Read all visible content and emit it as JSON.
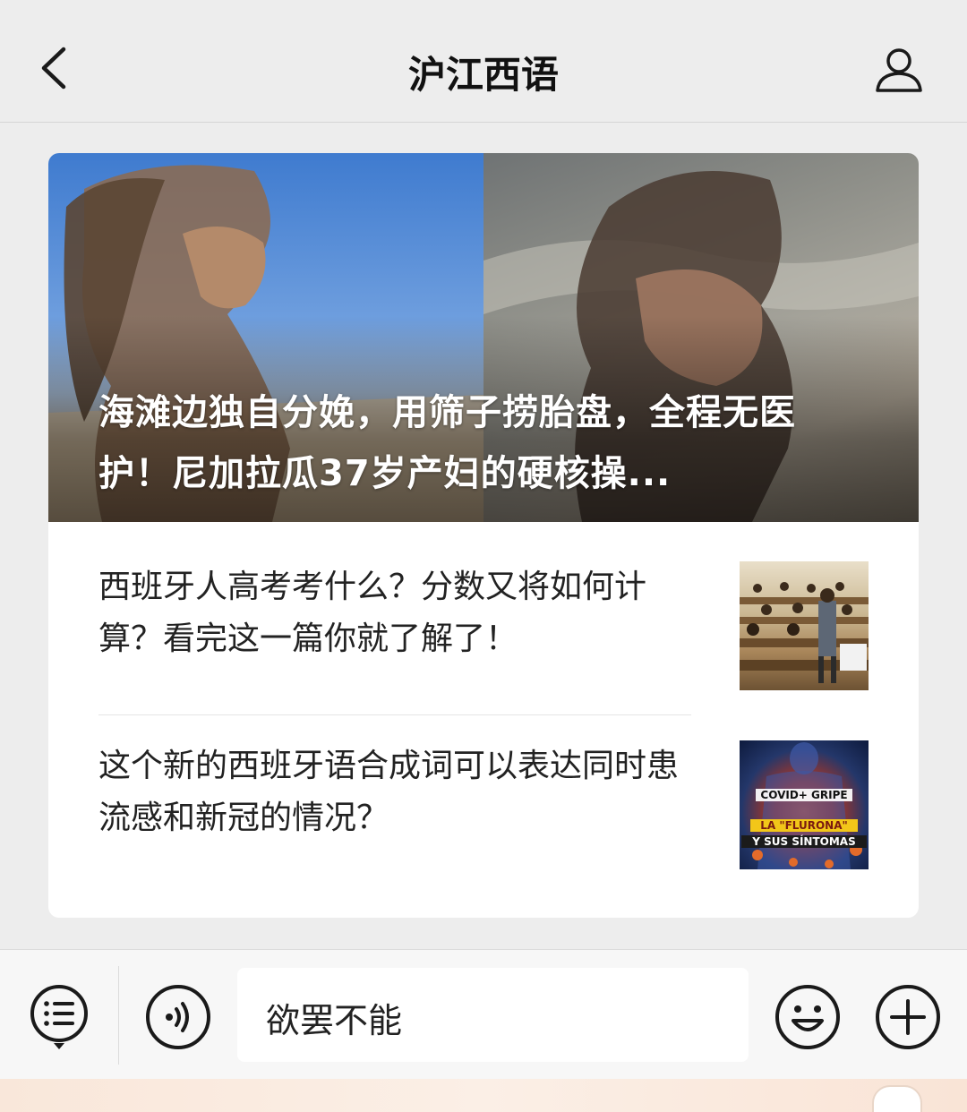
{
  "header": {
    "title": "沪江西语",
    "back_icon": "chevron-left-icon",
    "profile_icon": "person-icon"
  },
  "featured": {
    "title": "海滩边独自分娩，用筛子捞胎盘，全程无医护！尼加拉瓜37岁产妇的硬核操..."
  },
  "articles": [
    {
      "title": "西班牙人高考考什么？分数又将如何计算？看完这一篇你就了解了！",
      "thumbnail": "classroom-photo"
    },
    {
      "title": "这个新的西班牙语合成词可以表达同时患流感和新冠的情况？",
      "thumbnail": "covid-flurona-graphic"
    }
  ],
  "thumb_covid": {
    "line1": "COVID+ GRIPE",
    "line2": "LA \"FLURONA\"",
    "line3": "Y SUS SÍNTOMAS"
  },
  "input_bar": {
    "value": "欲罢不能",
    "menu_icon": "list-menu-icon",
    "voice_icon": "voice-icon",
    "emoji_icon": "emoji-icon",
    "plus_icon": "plus-icon"
  },
  "colors": {
    "background": "#ededed",
    "card": "#ffffff",
    "text": "#191919"
  }
}
